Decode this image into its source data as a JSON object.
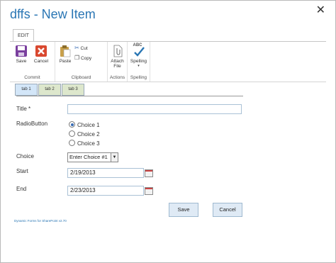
{
  "dialog": {
    "title": "dffs - New Item",
    "close_glyph": "✕"
  },
  "ribbon": {
    "tab_label": "EDIT",
    "groups": [
      {
        "label": "Commit"
      },
      {
        "label": "Clipboard"
      },
      {
        "label": "Actions"
      },
      {
        "label": "Spelling"
      }
    ],
    "buttons": {
      "save": "Save",
      "cancel": "Cancel",
      "paste": "Paste",
      "cut": "Cut",
      "copy": "Copy",
      "attach_line1": "Attach",
      "attach_line2": "File",
      "spelling": "Spelling",
      "spelling_sub": "▾",
      "abc": "ABC"
    }
  },
  "form_tabs": [
    "tab 1",
    "tab 2",
    "tab 3"
  ],
  "form": {
    "title_label": "Title *",
    "title_value": "",
    "radio_label": "RadioButton",
    "radio_options": [
      "Choice 1",
      "Choice 2",
      "Choice 3"
    ],
    "radio_selected": 0,
    "choice_label": "Choice",
    "choice_value": "Enter Choice #1",
    "start_label": "Start",
    "start_value": "2/19/2013",
    "end_label": "End",
    "end_value": "2/23/2013"
  },
  "actions": {
    "save": "Save",
    "cancel": "Cancel"
  },
  "footer": "Dynamic Forms for SharePoint v2.70",
  "colors": {
    "accent": "#2a76b4",
    "tab_active": "#d3e6f8",
    "tab_inactive": "#dde7cc"
  }
}
